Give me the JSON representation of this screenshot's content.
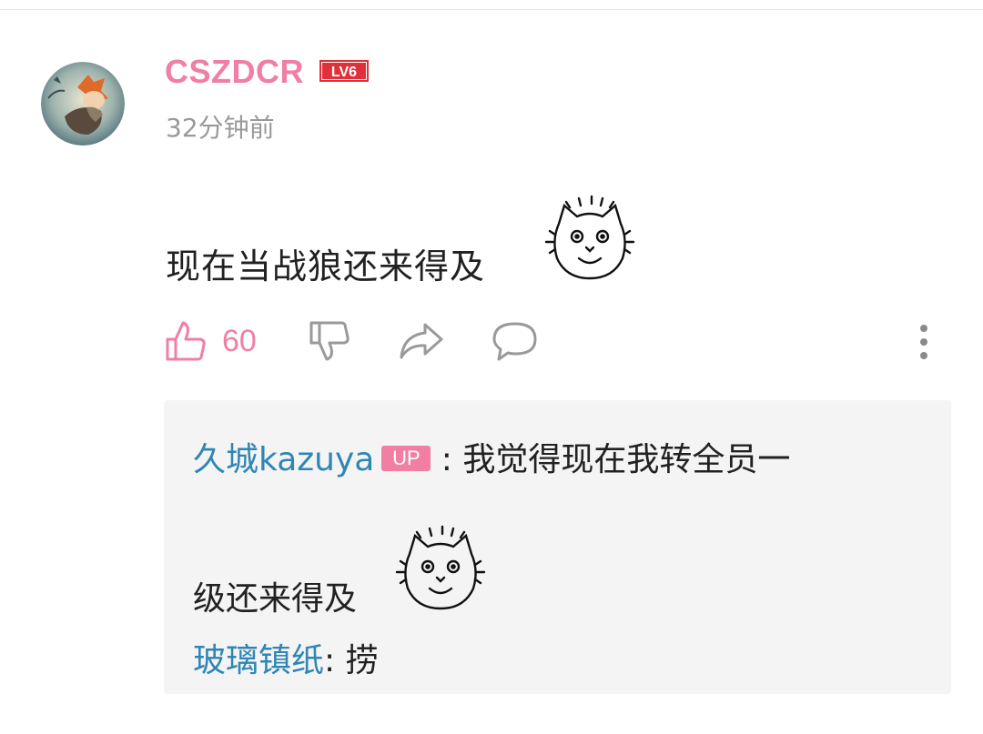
{
  "colors": {
    "username": "#f07fa3",
    "accent_pink": "#f07fa3",
    "level_badge": "#e0303a",
    "reply_author": "#2f86b4",
    "icon_gray": "#9a9a9a",
    "muted": "#999999"
  },
  "comment": {
    "username": "CSZDCR",
    "level": "LV6",
    "timestamp": "32分钟前",
    "text": "现在当战狼还来得及",
    "sticker": "cat-face-sticker",
    "likes": "60"
  },
  "icons": {
    "like": "thumbs-up-icon",
    "dislike": "thumbs-down-icon",
    "share": "share-icon",
    "reply": "comment-icon",
    "more": "more-vertical-icon"
  },
  "replies": [
    {
      "author": "久城kazuya",
      "badge": "UP",
      "separator": " : ",
      "text_line1": "我觉得现在我转全员一",
      "text_line2": "级还来得及",
      "sticker": "cat-face-sticker"
    },
    {
      "author": "玻璃镇纸",
      "separator": ": ",
      "text": "捞"
    }
  ]
}
